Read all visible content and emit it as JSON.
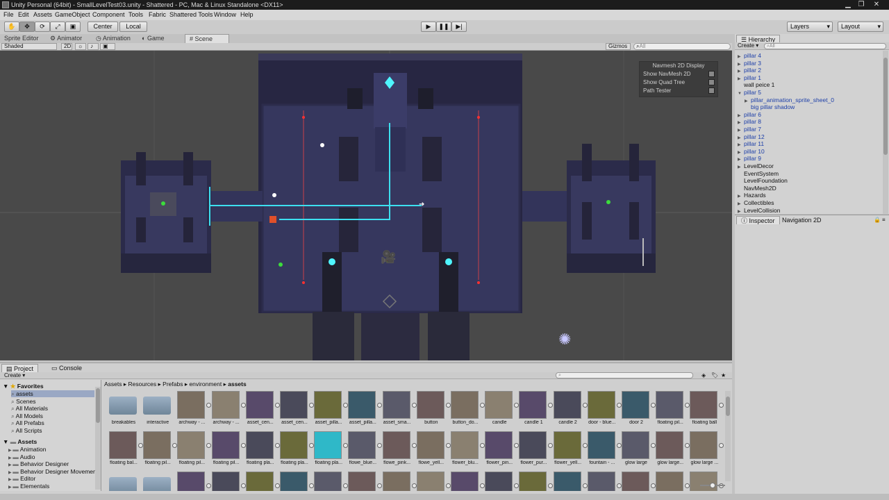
{
  "window": {
    "title": "Unity Personal (64bit) - SmallLevelTest03.unity - Shattered - PC, Mac & Linux Standalone <DX11>"
  },
  "menu": [
    "File",
    "Edit",
    "Assets",
    "GameObject",
    "Component",
    "Tools",
    "Fabric",
    "Shattered Tools",
    "Window",
    "Help"
  ],
  "toolbar": {
    "center": "Center",
    "local": "Local",
    "layers": "Layers",
    "layout": "Layout"
  },
  "tabs": {
    "sprite_editor": "Sprite Editor",
    "animator": "Animator",
    "animation": "Animation",
    "game": "Game",
    "scene": "Scene"
  },
  "scene_bar": {
    "shading": "Shaded",
    "mode2d": "2D",
    "gizmos": "Gizmos",
    "search": "All"
  },
  "navmesh_overlay": {
    "title": "Navmesh 2D Display",
    "items": [
      "Show NavMesh 2D",
      "Show Quad Tree",
      "Path Tester"
    ]
  },
  "hierarchy": {
    "tab": "Hierarchy",
    "create": "Create",
    "search": "All",
    "items": [
      {
        "label": "pillar 4",
        "arrow": "▶",
        "indent": 0,
        "blue": true
      },
      {
        "label": "pillar 3",
        "arrow": "▶",
        "indent": 0,
        "blue": true
      },
      {
        "label": "pillar 2",
        "arrow": "▶",
        "indent": 0,
        "blue": true
      },
      {
        "label": "pillar 1",
        "arrow": "▶",
        "indent": 0,
        "blue": true
      },
      {
        "label": "wall peice 1",
        "arrow": "",
        "indent": 0,
        "blue": false
      },
      {
        "label": "pillar 5",
        "arrow": "▼",
        "indent": 0,
        "blue": true
      },
      {
        "label": "pillar_animation_sprite_sheet_0",
        "arrow": "▶",
        "indent": 1,
        "blue": true
      },
      {
        "label": "big pillar shadow",
        "arrow": "",
        "indent": 1,
        "blue": true
      },
      {
        "label": "pillar 6",
        "arrow": "▶",
        "indent": 0,
        "blue": true
      },
      {
        "label": "pillar 8",
        "arrow": "▶",
        "indent": 0,
        "blue": true
      },
      {
        "label": "pillar 7",
        "arrow": "▶",
        "indent": 0,
        "blue": true
      },
      {
        "label": "pillar 12",
        "arrow": "▶",
        "indent": 0,
        "blue": true
      },
      {
        "label": "pillar 11",
        "arrow": "▶",
        "indent": 0,
        "blue": true
      },
      {
        "label": "pillar 10",
        "arrow": "▶",
        "indent": 0,
        "blue": true
      },
      {
        "label": "pillar 9",
        "arrow": "▶",
        "indent": 0,
        "blue": true
      },
      {
        "label": "LevelDecor",
        "arrow": "▶",
        "indent": 0,
        "blue": false
      },
      {
        "label": "EventSystem",
        "arrow": "",
        "indent": 0,
        "blue": false
      },
      {
        "label": "LevelFoundation",
        "arrow": "",
        "indent": 0,
        "blue": false
      },
      {
        "label": "NavMesh2D",
        "arrow": "",
        "indent": 0,
        "blue": false
      },
      {
        "label": "Hazards",
        "arrow": "▶",
        "indent": 0,
        "blue": false
      },
      {
        "label": "Collectibles",
        "arrow": "▶",
        "indent": 0,
        "blue": false
      },
      {
        "label": "LevelCollision",
        "arrow": "▶",
        "indent": 0,
        "blue": false
      }
    ]
  },
  "inspector": {
    "tab": "Inspector",
    "nav_tab": "Navigation 2D"
  },
  "project": {
    "tab": "Project",
    "console_tab": "Console",
    "create": "Create",
    "favorites_label": "Favorites",
    "favorites": [
      "assets",
      "Scenes",
      "All Materials",
      "All Models",
      "All Prefabs",
      "All Scripts"
    ],
    "assets_label": "Assets",
    "folders": [
      "Animation",
      "Audio",
      "Behavior Designer",
      "Behavior Designer Movemen",
      "Editor",
      "Elementals"
    ],
    "breadcrumb": [
      "Assets",
      "Resources",
      "Prefabs",
      "environment",
      "assets"
    ],
    "row1": [
      {
        "label": "breakables",
        "kind": "folder"
      },
      {
        "label": "interactive",
        "kind": "folder"
      },
      {
        "label": "archway - ...",
        "kind": "prefab"
      },
      {
        "label": "archway - ...",
        "kind": "prefab"
      },
      {
        "label": "asset_cen...",
        "kind": "prefab"
      },
      {
        "label": "asset_cen...",
        "kind": "prefab"
      },
      {
        "label": "asset_pilla...",
        "kind": "prefab"
      },
      {
        "label": "asset_pilla...",
        "kind": "prefab"
      },
      {
        "label": "asset_sma...",
        "kind": "prefab"
      },
      {
        "label": "button",
        "kind": "prefab"
      },
      {
        "label": "button_do...",
        "kind": "prefab"
      },
      {
        "label": "candle",
        "kind": "prefab"
      },
      {
        "label": "candle 1",
        "kind": "prefab"
      },
      {
        "label": "candle 2",
        "kind": "prefab"
      },
      {
        "label": "door - blue...",
        "kind": "prefab"
      },
      {
        "label": "door 2",
        "kind": "prefab"
      },
      {
        "label": "floating pil...",
        "kind": "prefab"
      },
      {
        "label": "floating ball",
        "kind": "prefab"
      }
    ],
    "row2": [
      {
        "label": "floating bal...",
        "kind": "prefab"
      },
      {
        "label": "floating pil...",
        "kind": "prefab"
      },
      {
        "label": "floating pil...",
        "kind": "prefab"
      },
      {
        "label": "floating pil...",
        "kind": "prefab"
      },
      {
        "label": "floating pla...",
        "kind": "prefab"
      },
      {
        "label": "floating pla...",
        "kind": "prefab"
      },
      {
        "label": "floating pla...",
        "kind": "prefab"
      },
      {
        "label": "flowe_blue...",
        "kind": "prefab"
      },
      {
        "label": "flowe_pink...",
        "kind": "prefab"
      },
      {
        "label": "flowe_yell...",
        "kind": "prefab"
      },
      {
        "label": "flower_blu...",
        "kind": "prefab"
      },
      {
        "label": "flower_pin...",
        "kind": "prefab"
      },
      {
        "label": "flower_pur...",
        "kind": "prefab"
      },
      {
        "label": "flower_yell...",
        "kind": "prefab"
      },
      {
        "label": "fountain - ...",
        "kind": "prefab"
      },
      {
        "label": "glow large",
        "kind": "prefab"
      },
      {
        "label": "glow large...",
        "kind": "prefab"
      },
      {
        "label": "glow large ...",
        "kind": "prefab"
      }
    ]
  }
}
